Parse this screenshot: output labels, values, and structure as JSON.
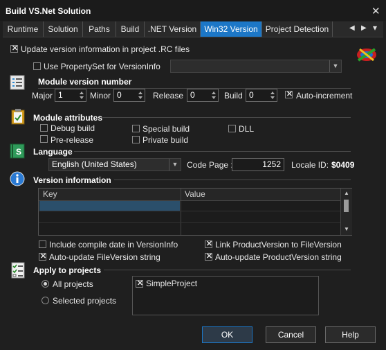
{
  "window": {
    "title": "Build VS.Net Solution",
    "close_glyph": "✕"
  },
  "tabs": [
    {
      "label": "Runtime"
    },
    {
      "label": "Solution"
    },
    {
      "label": "Paths"
    },
    {
      "label": "Build"
    },
    {
      "label": ".NET Version"
    },
    {
      "label": "Win32 Version"
    },
    {
      "label": "Project Detection"
    }
  ],
  "active_tab": "Win32 Version",
  "update_rc": {
    "label": "Update version information in project .RC files",
    "checked": true
  },
  "propertyset": {
    "label": "Use PropertySet for VersionInfo",
    "checked": false,
    "value": ""
  },
  "module_version": {
    "heading": "Module version number",
    "major_label": "Major",
    "major": "1",
    "minor_label": "Minor",
    "minor": "0",
    "release_label": "Release",
    "release": "0",
    "build_label": "Build",
    "build": "0",
    "auto_increment": {
      "label": "Auto-increment",
      "checked": true
    }
  },
  "module_attributes": {
    "heading": "Module attributes",
    "debug_build": {
      "label": "Debug build",
      "checked": false
    },
    "special_build": {
      "label": "Special build",
      "checked": false
    },
    "dll": {
      "label": "DLL",
      "checked": false
    },
    "pre_release": {
      "label": "Pre-release",
      "checked": false
    },
    "private_build": {
      "label": "Private build",
      "checked": false
    }
  },
  "language": {
    "heading": "Language",
    "selected": "English (United States)",
    "codepage_label": "Code Page :",
    "codepage": "1252",
    "locale_label": "Locale ID:",
    "locale": "$0409"
  },
  "version_info": {
    "heading": "Version information",
    "columns": [
      "Key",
      "Value"
    ],
    "selection_color": "#2b4f6b"
  },
  "options": {
    "compile_date": {
      "label": "Include compile date in VersionInfo",
      "checked": false
    },
    "link_product": {
      "label": "Link ProductVersion to FileVersion",
      "checked": true
    },
    "auto_file": {
      "label": "Auto-update FileVersion string",
      "checked": true
    },
    "auto_product": {
      "label": "Auto-update ProductVersion string",
      "checked": true
    }
  },
  "apply": {
    "heading": "Apply to projects",
    "all_projects": "All projects",
    "selected_projects": "Selected projects",
    "mode": "all",
    "projects": [
      {
        "label": "SimpleProject",
        "checked": true
      }
    ]
  },
  "buttons": {
    "ok": "OK",
    "cancel": "Cancel",
    "help": "Help"
  },
  "colors": {
    "accent": "#1c77c7",
    "background": "#1f1f1f"
  },
  "icons": {
    "module_version": "list-icon",
    "module_attributes": "clipboard-check-icon",
    "language": "language-book-icon",
    "version_info": "info-icon",
    "apply": "checklist-icon",
    "logo": "finalbuilder-logo-icon"
  }
}
